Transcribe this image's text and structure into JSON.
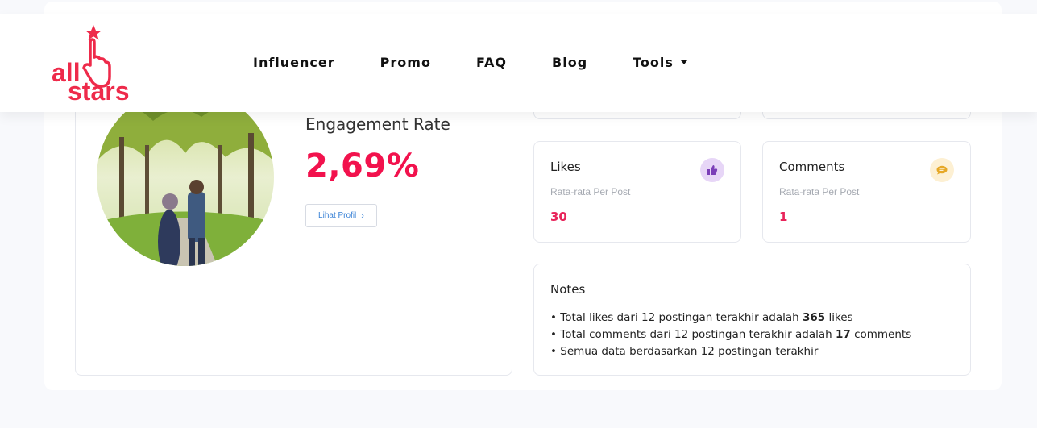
{
  "header": {
    "logo_text": "all stars",
    "nav": [
      {
        "label": "Influencer"
      },
      {
        "label": "Promo"
      },
      {
        "label": "FAQ"
      },
      {
        "label": "Blog"
      },
      {
        "label": "Tools",
        "has_dropdown": true
      }
    ]
  },
  "profile": {
    "engagement_label": "Engagement Rate",
    "engagement_value": "2,69%",
    "view_profile_label": "Lihat Profil"
  },
  "stats": {
    "likes": {
      "title": "Likes",
      "subtitle": "Rata-rata Per Post",
      "value": "30",
      "icon": "thumbs-up-icon"
    },
    "comments": {
      "title": "Comments",
      "subtitle": "Rata-rata Per Post",
      "value": "1",
      "icon": "speech-bubble-icon"
    }
  },
  "notes": {
    "title": "Notes",
    "items": [
      {
        "before": "Total likes dari 12 postingan terakhir adalah ",
        "bold": "365",
        "after": " likes"
      },
      {
        "before": "Total comments dari 12 postingan terakhir adalah ",
        "bold": "17",
        "after": " comments"
      },
      {
        "before": "Semua data berdasarkan 12 postingan terakhir",
        "bold": "",
        "after": ""
      }
    ]
  },
  "colors": {
    "accent_red": "#f2124d",
    "value_pink": "#e8245a",
    "link_blue": "#3a82d6",
    "likes_icon_bg": "#e7d6f7",
    "likes_icon": "#7b3fb8",
    "comments_icon_bg": "#fdf0d3",
    "comments_icon": "#e6a826"
  }
}
